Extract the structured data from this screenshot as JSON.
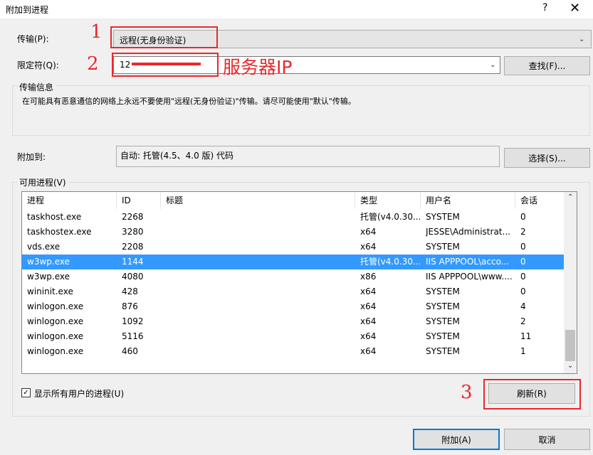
{
  "window": {
    "title": "附加到进程",
    "help_glyph": "?",
    "close_glyph": "✕"
  },
  "transport": {
    "label": "传输(P):",
    "value": "远程(无身份验证)"
  },
  "qualifier": {
    "label": "限定符(Q):",
    "value": "12",
    "find_button": "查找(F)..."
  },
  "transport_info": {
    "header": "传输信息",
    "text": "在可能具有恶意通信的网络上永远不要使用\"远程(无身份验证)\"传输。请尽可能使用\"默认\"传输。"
  },
  "attach_to": {
    "label": "附加到:",
    "value": "自动: 托管(4.5、4.0 版) 代码",
    "select_button": "选择(S)..."
  },
  "processes": {
    "label": "可用进程(V)",
    "columns": [
      "进程",
      "ID",
      "标题",
      "类型",
      "用户名",
      "会话"
    ],
    "rows": [
      {
        "name": "taskhost.exe",
        "id": "2268",
        "title": "",
        "type": "托管(v4.0.30...",
        "user": "SYSTEM",
        "session": "0",
        "selected": false
      },
      {
        "name": "taskhostex.exe",
        "id": "3280",
        "title": "",
        "type": "x64",
        "user": "JESSE\\Administrat...",
        "session": "2",
        "selected": false
      },
      {
        "name": "vds.exe",
        "id": "2208",
        "title": "",
        "type": "x64",
        "user": "SYSTEM",
        "session": "0",
        "selected": false
      },
      {
        "name": "w3wp.exe",
        "id": "1144",
        "title": "",
        "type": "托管(v4.0.30...",
        "user": "IIS APPPOOL\\acco...",
        "session": "0",
        "selected": true
      },
      {
        "name": "w3wp.exe",
        "id": "4080",
        "title": "",
        "type": "x86",
        "user": "IIS APPPOOL\\www....",
        "session": "0",
        "selected": false
      },
      {
        "name": "wininit.exe",
        "id": "428",
        "title": "",
        "type": "x64",
        "user": "SYSTEM",
        "session": "0",
        "selected": false
      },
      {
        "name": "winlogon.exe",
        "id": "876",
        "title": "",
        "type": "x64",
        "user": "SYSTEM",
        "session": "4",
        "selected": false
      },
      {
        "name": "winlogon.exe",
        "id": "1092",
        "title": "",
        "type": "x64",
        "user": "SYSTEM",
        "session": "2",
        "selected": false
      },
      {
        "name": "winlogon.exe",
        "id": "5116",
        "title": "",
        "type": "x64",
        "user": "SYSTEM",
        "session": "11",
        "selected": false
      },
      {
        "name": "winlogon.exe",
        "id": "460",
        "title": "",
        "type": "x64",
        "user": "SYSTEM",
        "session": "1",
        "selected": false
      }
    ],
    "show_all_users": {
      "label": "显示所有用户的进程(U)",
      "checked": true
    },
    "refresh_button": "刷新(R)"
  },
  "footer": {
    "attach_button": "附加(A)",
    "cancel_button": "取消"
  },
  "annotations": {
    "n1": "1",
    "n2": "2",
    "n3": "3",
    "server_ip": "服务器IP"
  },
  "colors": {
    "annotation_red": "#e8292c",
    "selection_blue": "#3399ff",
    "default_button_border": "#0078d7"
  }
}
